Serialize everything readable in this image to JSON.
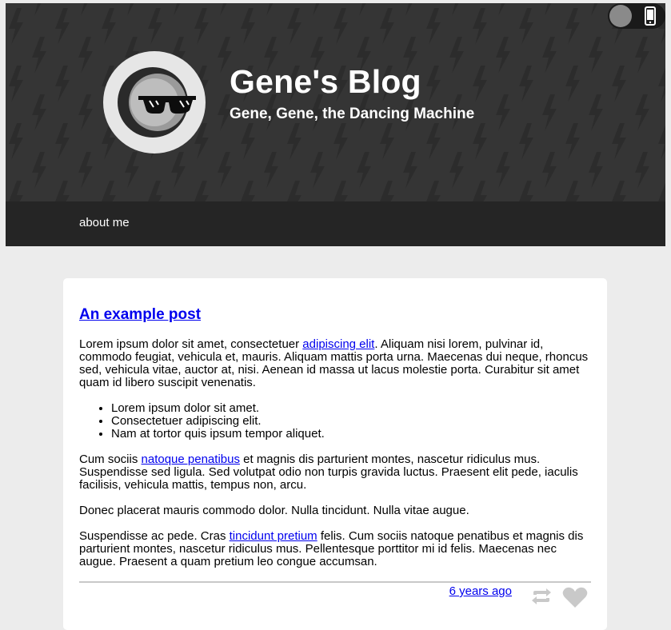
{
  "header": {
    "title": "Gene's Blog",
    "subtitle": "Gene, Gene, the Dancing Machine",
    "nav": [
      {
        "label": "about me"
      }
    ],
    "colors": {
      "background": "#353535",
      "nav_background": "#252525",
      "pattern_bolt": "#2b2b2b"
    }
  },
  "toggle": {
    "icon": "mobile-phone-icon"
  },
  "avatar": {
    "icon": "sunglasses-face-icon"
  },
  "post": {
    "title": "An example post",
    "paragraph1": {
      "before": "Lorem ipsum dolor sit amet, consectetuer ",
      "link": "adipiscing elit",
      "after": ". Aliquam nisi lorem, pulvinar id, commodo feugiat, vehicula et, mauris. Aliquam mattis porta urna. Maecenas dui neque, rhoncus sed, vehicula vitae, auctor at, nisi. Aenean id massa ut lacus molestie porta. Curabitur sit amet quam id libero suscipit venenatis."
    },
    "list": [
      "Lorem ipsum dolor sit amet.",
      "Consectetuer adipiscing elit.",
      "Nam at tortor quis ipsum tempor aliquet."
    ],
    "paragraph2": {
      "before": "Cum sociis ",
      "link": "natoque penatibus",
      "after": " et magnis dis parturient montes, nascetur ridiculus mus. Suspendisse sed ligula. Sed volutpat odio non turpis gravida luctus. Praesent elit pede, iaculis facilisis, vehicula mattis, tempus non, arcu."
    },
    "quote": "Donec placerat mauris commodo dolor. Nulla tincidunt. Nulla vitae augue.",
    "paragraph3": {
      "before": "Suspendisse ac pede. Cras ",
      "link": "tincidunt pretium",
      "after": " felis. Cum sociis natoque penatibus et magnis dis parturient montes, nascetur ridiculus mus. Pellentesque porttitor mi id felis. Maecenas nec augue. Praesent a quam pretium leo congue accumsan."
    },
    "footer": {
      "date": "6 years ago",
      "reblog_icon": "reblog-icon",
      "like_icon": "heart-icon"
    }
  },
  "colors": {
    "page_background": "#ececec",
    "link": "#0000ee",
    "icon_gray": "#c9c9c9"
  }
}
